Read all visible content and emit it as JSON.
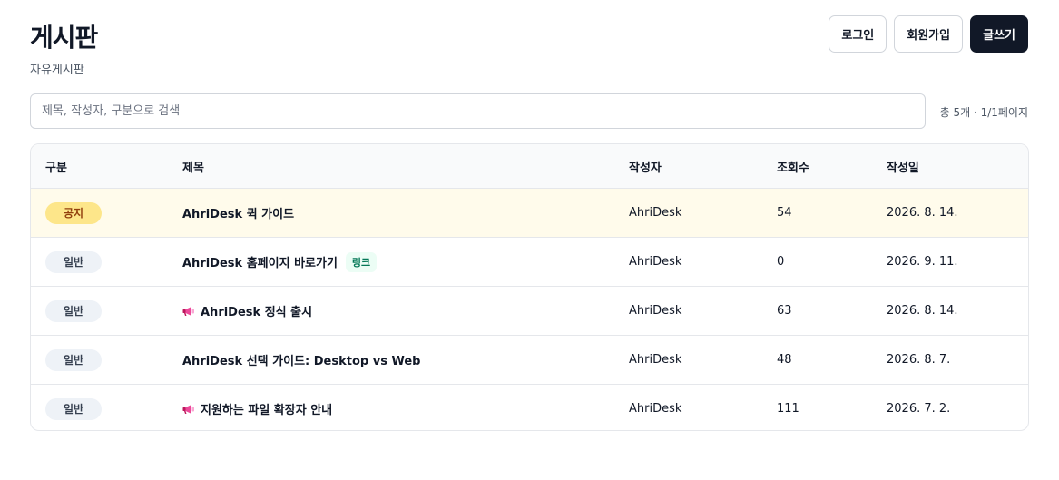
{
  "header": {
    "title": "게시판",
    "subtitle": "자유게시판",
    "login_label": "로그인",
    "signup_label": "회원가입",
    "write_label": "글쓰기"
  },
  "search": {
    "placeholder": "제목, 작성자, 구분으로 검색",
    "value": ""
  },
  "meta": {
    "summary": "총 5개 · 1/1페이지"
  },
  "table": {
    "columns": {
      "category": "구분",
      "title": "제목",
      "author": "작성자",
      "views": "조회수",
      "date": "작성일"
    },
    "rows": [
      {
        "category": "공지",
        "title": "AhriDesk 퀵 가이드",
        "tag": "",
        "icon": "",
        "author": "AhriDesk",
        "views": "54",
        "date": "2026. 8. 14."
      },
      {
        "category": "일반",
        "title": "AhriDesk 홈페이지 바로가기",
        "tag": "링크",
        "icon": "",
        "author": "AhriDesk",
        "views": "0",
        "date": "2026. 9. 11."
      },
      {
        "category": "일반",
        "title": "AhriDesk 정식 출시",
        "tag": "",
        "icon": "megaphone-icon",
        "author": "AhriDesk",
        "views": "63",
        "date": "2026. 8. 14."
      },
      {
        "category": "일반",
        "title": "AhriDesk 선택 가이드: Desktop vs Web",
        "tag": "",
        "icon": "",
        "author": "AhriDesk",
        "views": "48",
        "date": "2026. 8. 7."
      },
      {
        "category": "일반",
        "title": "지원하는 파일 확장자 안내",
        "tag": "",
        "icon": "megaphone-icon",
        "author": "AhriDesk",
        "views": "111",
        "date": "2026. 7. 2."
      }
    ]
  },
  "colors": {
    "primary": "#111827",
    "notice_row": "#fffbeb",
    "notice_badge": "#fde68a",
    "general_badge": "#eef2f7",
    "link_tag": "#047857",
    "megaphone": "#db2777"
  }
}
